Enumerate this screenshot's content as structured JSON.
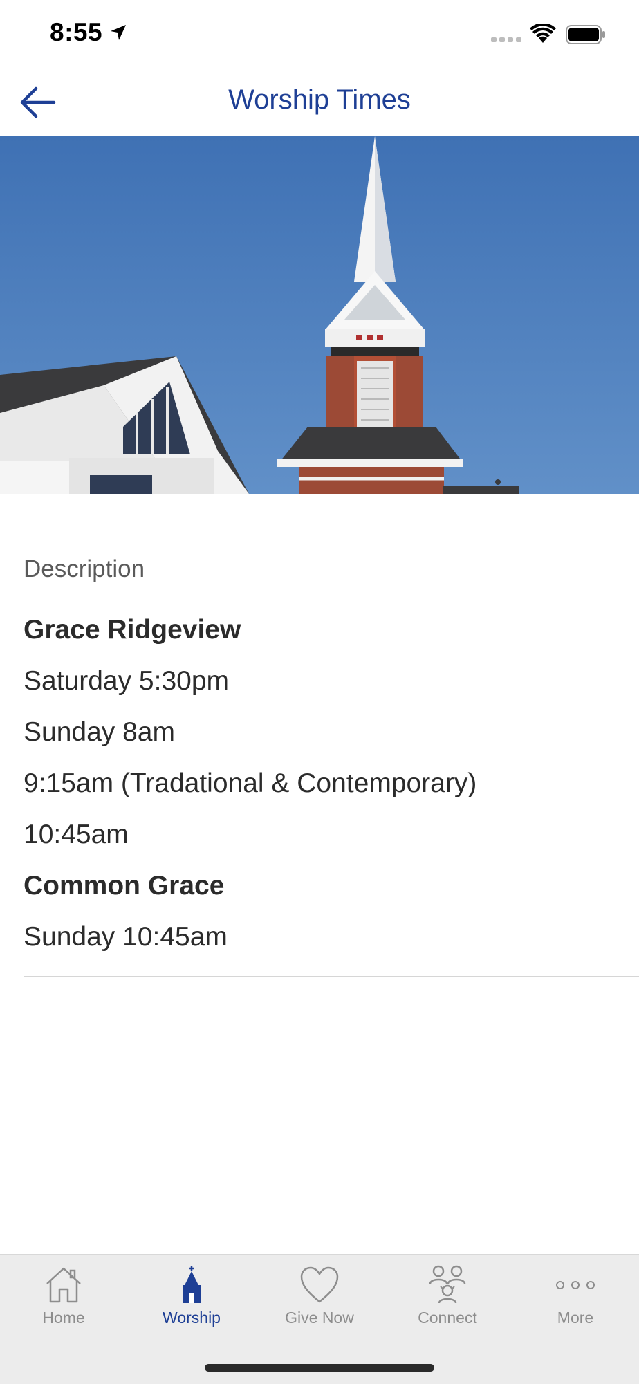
{
  "status_bar": {
    "time": "8:55"
  },
  "nav": {
    "title": "Worship Times"
  },
  "content": {
    "section_label": "Description",
    "lines": [
      {
        "text": "Grace Ridgeview",
        "bold": true
      },
      {
        "text": "Saturday 5:30pm",
        "bold": false
      },
      {
        "text": "Sunday 8am",
        "bold": false
      },
      {
        "text": "9:15am (Tradational & Contemporary)",
        "bold": false
      },
      {
        "text": "10:45am",
        "bold": false
      },
      {
        "text": "Common Grace",
        "bold": true
      },
      {
        "text": "Sunday 10:45am",
        "bold": false
      }
    ]
  },
  "tabs": [
    {
      "label": "Home",
      "icon": "home-icon",
      "active": false
    },
    {
      "label": "Worship",
      "icon": "church-icon",
      "active": true
    },
    {
      "label": "Give Now",
      "icon": "heart-icon",
      "active": false
    },
    {
      "label": "Connect",
      "icon": "people-icon",
      "active": false
    },
    {
      "label": "More",
      "icon": "more-icon",
      "active": false
    }
  ],
  "colors": {
    "accent": "#1e3f95",
    "tab_inactive": "#8d8d8d",
    "tab_bg": "#ececec",
    "sky": "#4f7fbd"
  }
}
